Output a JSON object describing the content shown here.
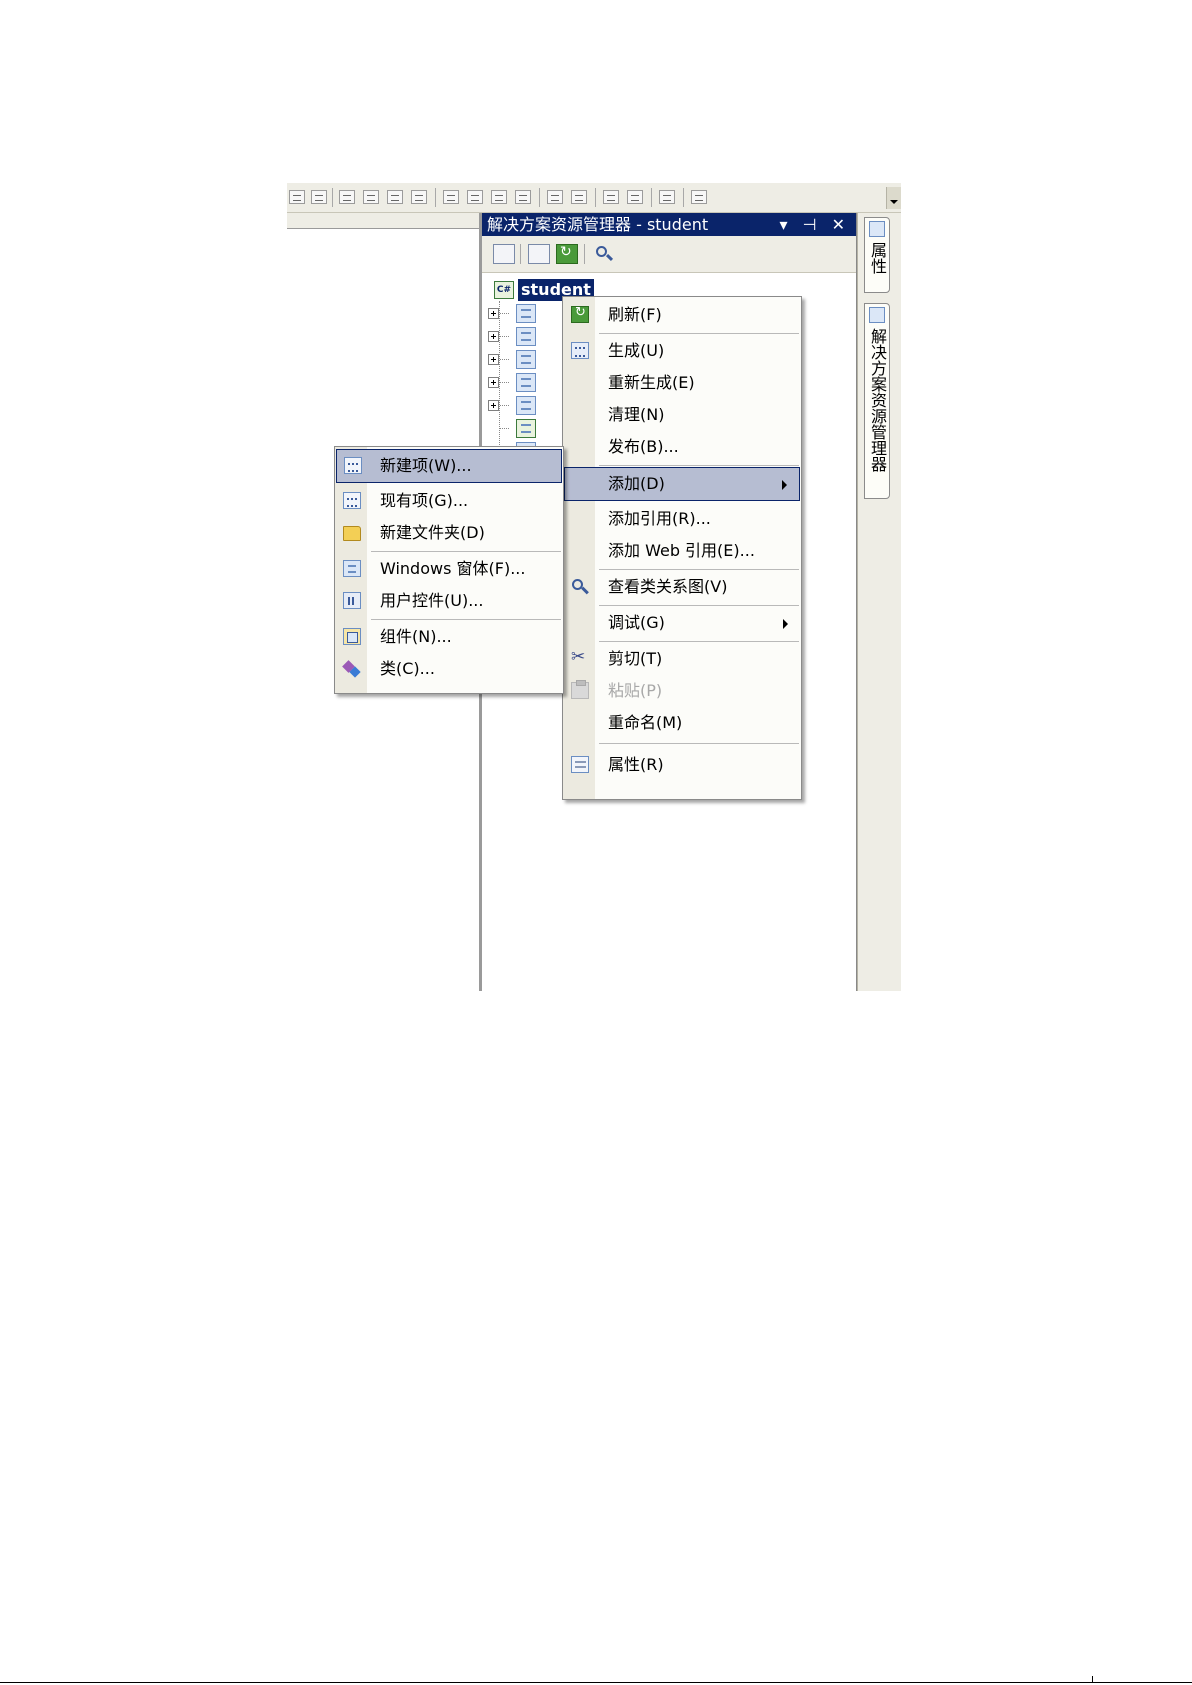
{
  "solution_explorer": {
    "title": "解决方案资源管理器 - student",
    "title_buttons": "▾ ⊣ ✕",
    "project_name": "student",
    "tools": [
      "properties-icon",
      "show-all-files-icon",
      "refresh-icon",
      "class-view-icon"
    ],
    "tree_nodes": [
      "properties-node-icon",
      "references-node-icon",
      "form-node-icon",
      "form-node-icon",
      "form-node-icon",
      "csharp-file-icon",
      "form-node-icon"
    ]
  },
  "side_tabs": {
    "properties": "属性",
    "solution_explorer": "解决方案资源管理器"
  },
  "context_menu": {
    "items": [
      {
        "label": "刷新(F)",
        "icon": "refresh-icon"
      },
      {
        "label": "生成(U)",
        "icon": "build-icon"
      },
      {
        "label": "重新生成(E)",
        "icon": ""
      },
      {
        "label": "清理(N)",
        "icon": ""
      },
      {
        "label": "发布(B)...",
        "icon": ""
      },
      {
        "label": "添加(D)",
        "icon": "",
        "highlighted": true,
        "submenu": true
      },
      {
        "label": "添加引用(R)...",
        "icon": ""
      },
      {
        "label": "添加 Web 引用(E)...",
        "icon": ""
      },
      {
        "label": "查看类关系图(V)",
        "icon": "class-diagram-icon"
      },
      {
        "label": "调试(G)",
        "icon": "",
        "submenu": true
      },
      {
        "label": "剪切(T)",
        "icon": "scissors-icon"
      },
      {
        "label": "粘贴(P)",
        "icon": "paste-icon",
        "disabled": true
      },
      {
        "label": "重命名(M)",
        "icon": ""
      },
      {
        "label": "属性(R)",
        "icon": "properties-icon"
      }
    ]
  },
  "add_submenu": {
    "items": [
      {
        "label": "新建项(W)...",
        "icon": "new-item-icon",
        "highlighted": true
      },
      {
        "label": "现有项(G)...",
        "icon": "existing-item-icon"
      },
      {
        "label": "新建文件夹(D)",
        "icon": "folder-icon"
      },
      {
        "label": "Windows 窗体(F)...",
        "icon": "windows-form-icon"
      },
      {
        "label": "用户控件(U)...",
        "icon": "user-control-icon"
      },
      {
        "label": "组件(N)...",
        "icon": "component-icon"
      },
      {
        "label": "类(C)...",
        "icon": "class-icon"
      }
    ]
  },
  "colors": {
    "title_bar": "#0a246a",
    "menu_highlight": "#b6bdd2",
    "menu_background": "#fcfcf9",
    "menu_gutter": "#eceae0",
    "toolbar": "#eeede5"
  }
}
